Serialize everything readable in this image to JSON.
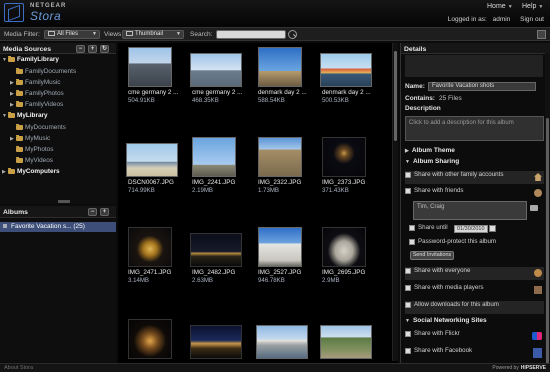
{
  "header": {
    "brand_top": "NETGEAR",
    "brand_name": "Stora",
    "home": "Home",
    "help": "Help",
    "logged_in_label": "Logged in as:",
    "user": "admin",
    "sign_out": "Sign out"
  },
  "toolbar": {
    "media_filter_label": "Media Filter:",
    "media_filter_value": "All Files",
    "views_label": "Views",
    "views_value": "Thumbnail",
    "search_label": "Search:",
    "search_value": ""
  },
  "sources": {
    "title": "Media Sources",
    "tree": [
      {
        "label": "FamilyLibrary",
        "root": true,
        "exp": "▼"
      },
      {
        "label": "FamilyDocuments",
        "root": false,
        "exp": ""
      },
      {
        "label": "FamilyMusic",
        "root": false,
        "exp": "▶"
      },
      {
        "label": "FamilyPhotos",
        "root": false,
        "exp": "▶"
      },
      {
        "label": "FamilyVideos",
        "root": false,
        "exp": "▶"
      },
      {
        "label": "MyLibrary",
        "root": true,
        "exp": "▼"
      },
      {
        "label": "MyDocuments",
        "root": false,
        "exp": ""
      },
      {
        "label": "MyMusic",
        "root": false,
        "exp": "▶"
      },
      {
        "label": "MyPhotos",
        "root": false,
        "exp": ""
      },
      {
        "label": "MyVideos",
        "root": false,
        "exp": ""
      },
      {
        "label": "MyComputers",
        "root": true,
        "exp": "▶"
      }
    ]
  },
  "albums": {
    "title": "Albums",
    "items": [
      {
        "label": "Favorite Vacation s... (25)"
      }
    ]
  },
  "grid": {
    "items": [
      {
        "name": "cme germany 2 ...",
        "size": "504.91KB",
        "scene": "cathedral-day"
      },
      {
        "name": "cme germany 2 ...",
        "size": "468.35KB",
        "scene": "bridge-river"
      },
      {
        "name": "denmark day 2 ...",
        "size": "588.54KB",
        "scene": "tower-city"
      },
      {
        "name": "denmark day 2 ...",
        "size": "500.53KB",
        "scene": "harbor"
      },
      {
        "name": "DSCN0067.JPG",
        "size": "714.99KB",
        "scene": "beach"
      },
      {
        "name": "IMG_2241.JPG",
        "size": "2.19MB",
        "scene": "eiffel-day"
      },
      {
        "name": "IMG_2322.JPG",
        "size": "1.73MB",
        "scene": "notre-dame"
      },
      {
        "name": "IMG_2373.JPG",
        "size": "371.43KB",
        "scene": "eiffel-night"
      },
      {
        "name": "IMG_2471.JPG",
        "size": "3.14MB",
        "scene": "eiffel-gold"
      },
      {
        "name": "IMG_2482.JPG",
        "size": "2.63MB",
        "scene": "city-night"
      },
      {
        "name": "IMG_2527.JPG",
        "size": "946.78KB",
        "scene": "sacre-coeur"
      },
      {
        "name": "IMG_2695.JPG",
        "size": "2.9MB",
        "scene": "sacre-coeur-2"
      },
      {
        "name": "",
        "size": "",
        "scene": "arc-night"
      },
      {
        "name": "",
        "size": "",
        "scene": "louvre-night"
      },
      {
        "name": "",
        "size": "",
        "scene": "river-boat"
      },
      {
        "name": "",
        "size": "",
        "scene": "park-path"
      }
    ]
  },
  "details": {
    "title": "Details",
    "name_label": "Name:",
    "name_value": "Favorite Vacation shots",
    "contains_label": "Contains:",
    "contains_value": "25 Files",
    "description_label": "Description",
    "description_placeholder": "Click to add a description for this album",
    "album_theme": "Album Theme",
    "album_sharing": "Album Sharing",
    "share_family": "Share with other family accounts",
    "share_friends": "Share with friends",
    "friends_value": "Tim, Craig",
    "share_until": "Share until",
    "share_until_date": "01/30/2010",
    "password_protect": "Password-protect this album",
    "send_invitations": "Send Invitations",
    "share_everyone": "Share with everyone",
    "share_media_players": "Share with media players",
    "allow_downloads": "Allow downloads for this album",
    "social_networking": "Social Networking Sites",
    "share_flickr": "Share with Flickr",
    "share_facebook": "Share with Facebook"
  },
  "footer": {
    "about": "About Stora",
    "powered_by": "Powered by",
    "powered_brand": "HIPSERVE"
  },
  "colors": {
    "accent": "#3d4e79",
    "folder": "#c9a046",
    "brand": "#6a9ad8"
  }
}
